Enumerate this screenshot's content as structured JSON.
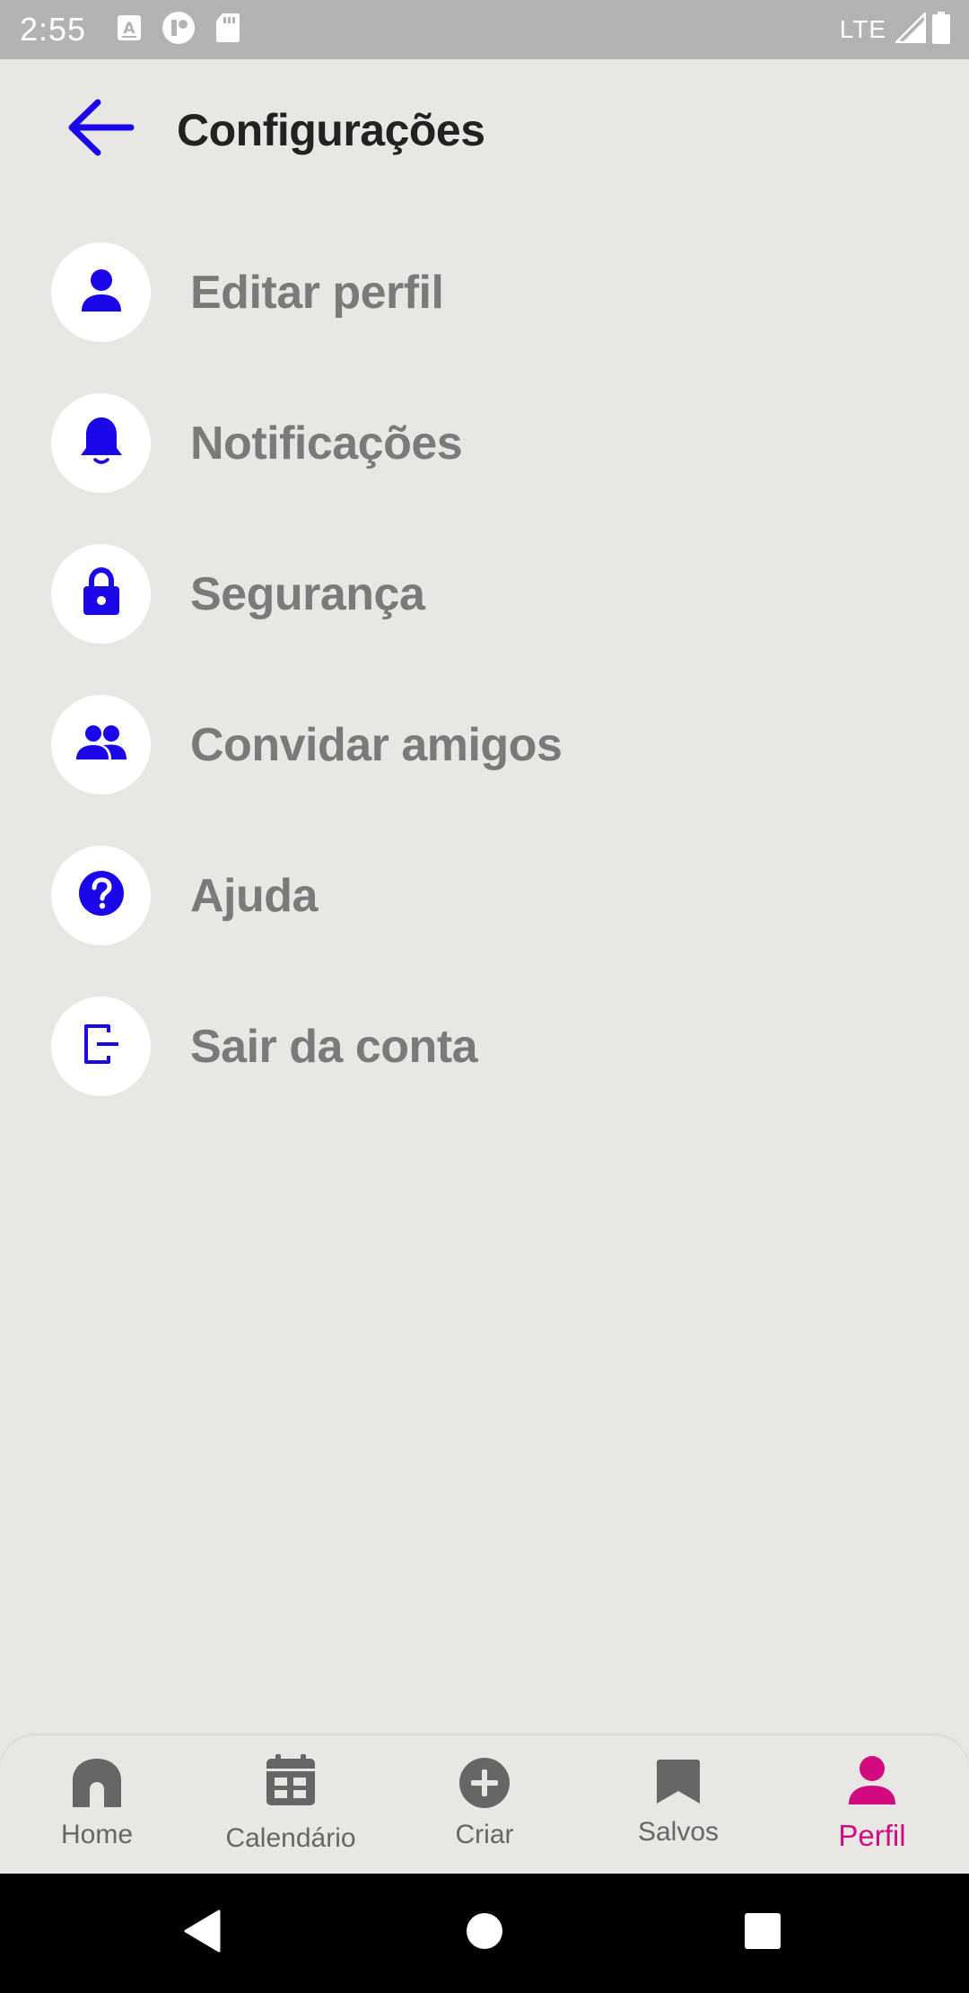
{
  "status_bar": {
    "time": "2:55",
    "network": "LTE",
    "icons": [
      "keyboard-a-icon",
      "app-notification-icon",
      "sd-card-icon",
      "cell-signal-icon",
      "battery-icon"
    ]
  },
  "header": {
    "title": "Configurações",
    "back_icon": "arrow-left-icon"
  },
  "settings": {
    "items": [
      {
        "label": "Editar perfil",
        "icon": "person-icon"
      },
      {
        "label": "Notificações",
        "icon": "bell-icon"
      },
      {
        "label": "Segurança",
        "icon": "lock-icon"
      },
      {
        "label": "Convidar amigos",
        "icon": "people-icon"
      },
      {
        "label": "Ajuda",
        "icon": "help-circle-icon"
      },
      {
        "label": "Sair da conta",
        "icon": "logout-icon"
      }
    ]
  },
  "bottom_nav": {
    "tabs": [
      {
        "label": "Home",
        "icon": "home-icon",
        "active": false
      },
      {
        "label": "Calendário",
        "icon": "calendar-icon",
        "active": false
      },
      {
        "label": "Criar",
        "icon": "add-circle-icon",
        "active": false
      },
      {
        "label": "Salvos",
        "icon": "bookmark-icon",
        "active": false
      },
      {
        "label": "Perfil",
        "icon": "person-icon",
        "active": true
      }
    ]
  },
  "system_nav": {
    "buttons": [
      "back-triangle-icon",
      "home-circle-icon",
      "recents-square-icon"
    ]
  },
  "colors": {
    "accent": "#1a06e8",
    "active_tab": "#d10a7f",
    "background": "#e8e7e4",
    "menu_text": "#7a7a7a",
    "nav_icon": "#666666"
  }
}
